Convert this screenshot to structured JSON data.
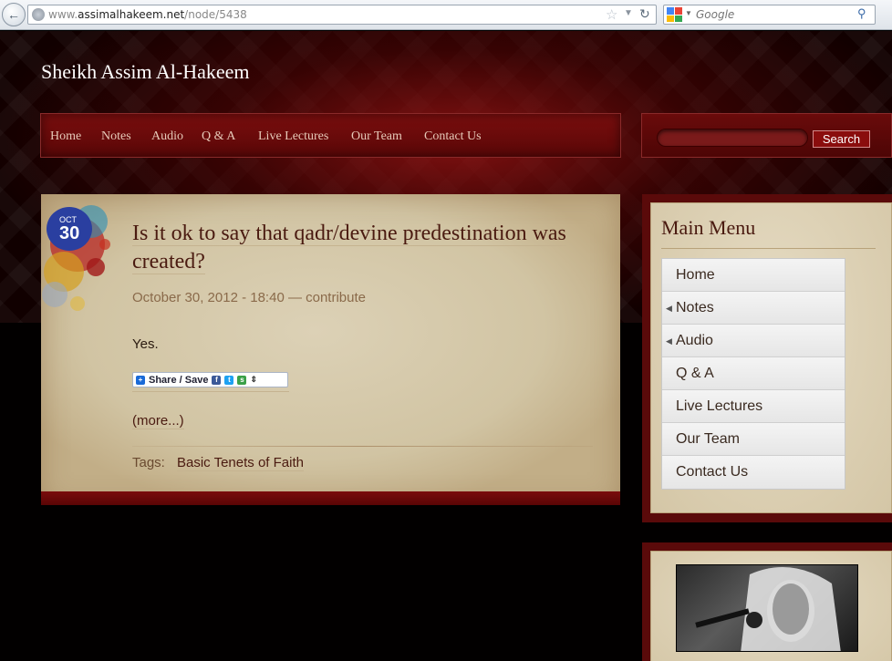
{
  "browser": {
    "url_prefix": "www.",
    "url_domain": "assimalhakeem.net",
    "url_path": "/node/5438",
    "search_placeholder": "Google"
  },
  "site": {
    "title": "Sheikh Assim Al-Hakeem",
    "nav": [
      "Home",
      "Notes",
      "Audio",
      "Q & A",
      "Live Lectures",
      "Our Team",
      "Contact Us"
    ],
    "search_button": "Search"
  },
  "article": {
    "date_month": "OCT",
    "date_day": "30",
    "title": "Is it ok to say that qadr/devine predestination was created?",
    "meta": "October 30, 2012 - 18:40 — contribute",
    "body": "Yes.",
    "share_label": "Share / Save",
    "more_link": "(more...)",
    "tags_label": "Tags:",
    "tag": "Basic Tenets of Faith"
  },
  "sidebar": {
    "menu_title": "Main Menu",
    "menu_items": [
      {
        "label": "Home",
        "expandable": false
      },
      {
        "label": "Notes",
        "expandable": true
      },
      {
        "label": "Audio",
        "expandable": true
      },
      {
        "label": "Q & A",
        "expandable": false
      },
      {
        "label": "Live Lectures",
        "expandable": false
      },
      {
        "label": "Our Team",
        "expandable": false
      },
      {
        "label": "Contact Us",
        "expandable": false
      }
    ]
  },
  "colors": {
    "nav_bg": "#6a0a0a",
    "article_bg": "#d8cbb0",
    "title_text": "#4a1a10",
    "date_badge": "#2a3fa0"
  }
}
